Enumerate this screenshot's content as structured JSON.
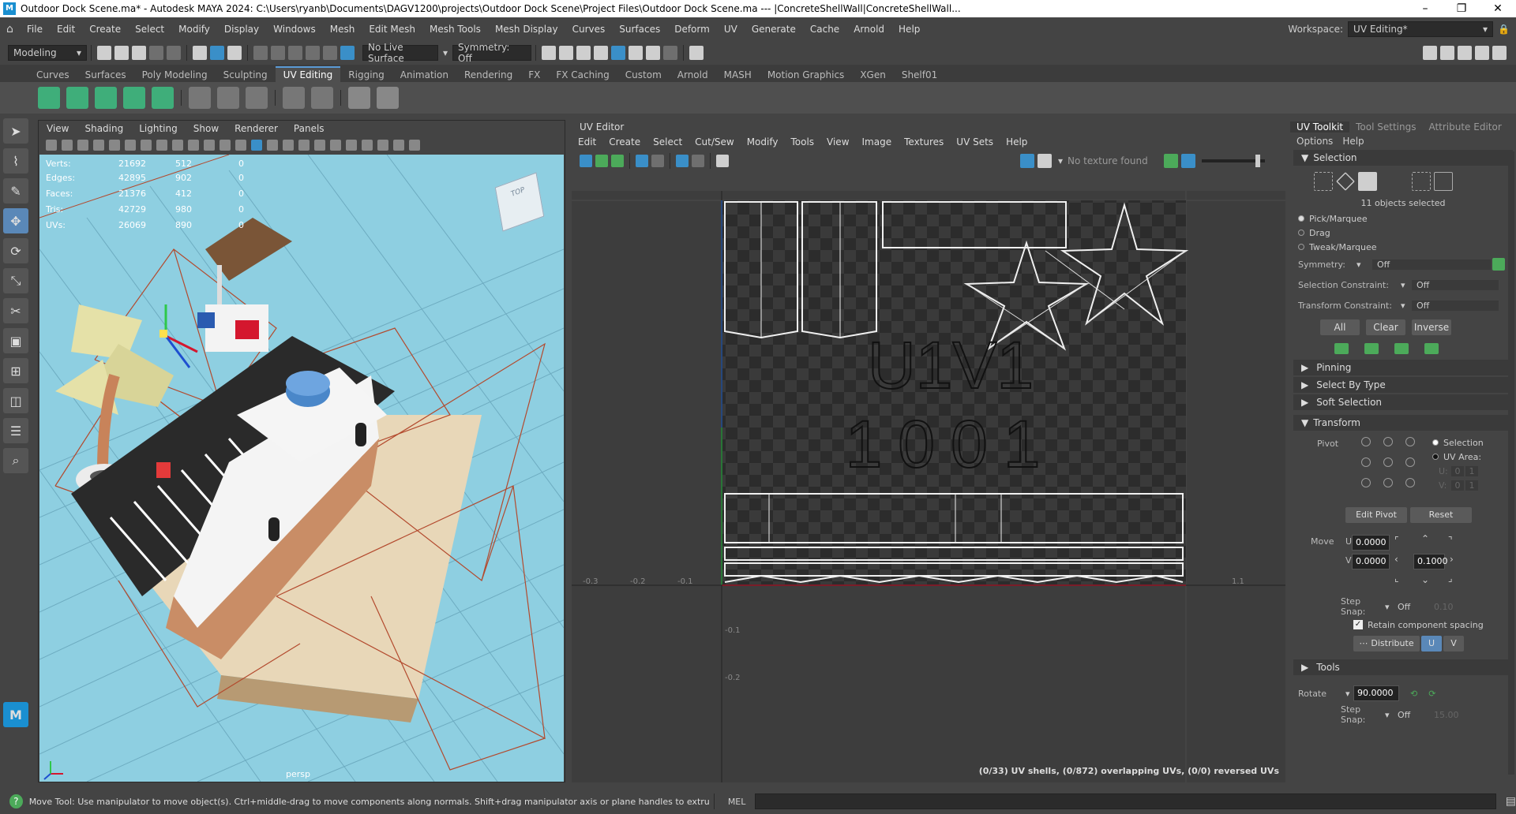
{
  "window": {
    "title": "Outdoor Dock Scene.ma* - Autodesk MAYA 2024: C:\\Users\\ryanb\\Documents\\DAGV1200\\projects\\Outdoor Dock Scene\\Project Files\\Outdoor Dock Scene.ma   ---   |ConcreteShellWall|ConcreteShellWall..."
  },
  "menubar": {
    "items": [
      "File",
      "Edit",
      "Create",
      "Select",
      "Modify",
      "Display",
      "Windows",
      "Mesh",
      "Edit Mesh",
      "Mesh Tools",
      "Mesh Display",
      "Curves",
      "Surfaces",
      "Deform",
      "UV",
      "Generate",
      "Cache",
      "Arnold",
      "Help"
    ],
    "workspace_label": "Workspace:",
    "workspace_value": "UV Editing*"
  },
  "statusline": {
    "mode": "Modeling",
    "live_surface": "No Live Surface",
    "symmetry": "Symmetry: Off"
  },
  "shelf": {
    "tabs": [
      "Curves",
      "Surfaces",
      "Poly Modeling",
      "Sculpting",
      "UV Editing",
      "Rigging",
      "Animation",
      "Rendering",
      "FX",
      "FX Caching",
      "Custom",
      "Arnold",
      "MASH",
      "Motion Graphics",
      "XGen",
      "Shelf01"
    ],
    "active": "UV Editing"
  },
  "viewport": {
    "menu": [
      "View",
      "Shading",
      "Lighting",
      "Show",
      "Renderer",
      "Panels"
    ],
    "camera": "persp",
    "hud": [
      {
        "label": "Verts:",
        "a": "21692",
        "b": "512",
        "c": "0"
      },
      {
        "label": "Edges:",
        "a": "42895",
        "b": "902",
        "c": "0"
      },
      {
        "label": "Faces:",
        "a": "21376",
        "b": "412",
        "c": "0"
      },
      {
        "label": "Tris:",
        "a": "42729",
        "b": "980",
        "c": "0"
      },
      {
        "label": "UVs:",
        "a": "26069",
        "b": "890",
        "c": "0"
      }
    ],
    "cube_label": "TOP"
  },
  "uveditor": {
    "title": "UV Editor",
    "menu": [
      "Edit",
      "Create",
      "Select",
      "Cut/Sew",
      "Modify",
      "Tools",
      "View",
      "Image",
      "Textures",
      "UV Sets",
      "Help"
    ],
    "texture_status": "No texture found",
    "tile_text_1": "U1V1",
    "tile_text_2": "1001",
    "status": "(0/33) UV shells, (0/872) overlapping UVs, (0/0) reversed UVs",
    "xticks": [
      "-0.3",
      "-0.2",
      "-0.1",
      "1.1"
    ],
    "yticks": [
      "-0.1",
      "-0.2"
    ]
  },
  "uvtoolkit": {
    "tabs": [
      "UV Toolkit",
      "Tool Settings",
      "Attribute Editor"
    ],
    "menu": [
      "Options",
      "Help"
    ],
    "selection_header": "Selection",
    "selected_count": "11 objects selected",
    "pick_modes": [
      "Pick/Marquee",
      "Drag",
      "Tweak/Marquee"
    ],
    "symmetry_label": "Symmetry:",
    "symmetry_value": "Off",
    "sel_constraint_label": "Selection Constraint:",
    "sel_constraint_value": "Off",
    "xform_constraint_label": "Transform Constraint:",
    "xform_constraint_value": "Off",
    "buttons": [
      "All",
      "Clear",
      "Inverse"
    ],
    "sections": [
      "Pinning",
      "Select By Type",
      "Soft Selection"
    ],
    "transform_header": "Transform",
    "pivot_label": "Pivot",
    "pivot_selection": "Selection",
    "pivot_uvarea": "UV Area:",
    "pivot_u": "U:",
    "pivot_v": "V:",
    "pivot_u_val": "0",
    "pivot_u_val2": "1",
    "pivot_v_val": "0",
    "pivot_v_val2": "1",
    "edit_pivot": "Edit Pivot",
    "reset": "Reset",
    "move_label": "Move",
    "u_label": "U",
    "v_label": "V",
    "move_u": "0.0000",
    "move_v": "0.0000",
    "move_step": "0.1000",
    "step_snap_label": "Step Snap:",
    "step_snap_value": "Off",
    "step_snap_num": "0.10",
    "retain": "Retain component spacing",
    "distribute": "Distribute",
    "dist_u": "U",
    "dist_v": "V",
    "tools_header": "Tools",
    "rotate_label": "Rotate",
    "rotate_value": "90.0000",
    "step_snap2_label": "Step Snap:",
    "step_snap2_value": "Off",
    "step_snap2_num": "15.00"
  },
  "helpline": {
    "text": "Move Tool: Use manipulator to move object(s). Ctrl+middle-drag to move components along normals. Shift+drag manipulator axis or plane handles to extrude components or clone objects. Ctrl+Shift+drag to c",
    "mel": "MEL"
  },
  "colors": {
    "accent": "#5a9ad6",
    "viewport_bg": "#8ecfe1",
    "maya_logo": "#1a8fd0"
  }
}
